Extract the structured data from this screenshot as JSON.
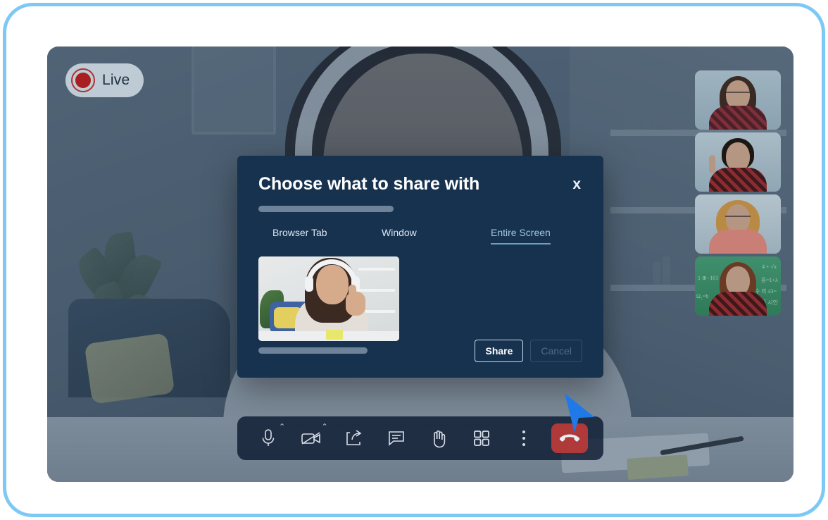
{
  "stage": {
    "live_badge": {
      "label": "Live",
      "icon": "record-dot-icon",
      "dot_color": "#a81f1f",
      "pill_color": "#dfe9f0"
    },
    "main_video_description": "Woman wearing white headphones smiling at camera"
  },
  "participants": [
    {
      "name_icon": "participant-thumbnail",
      "description": "Woman with glasses in plaid shirt"
    },
    {
      "name_icon": "participant-thumbnail",
      "description": "Man in red plaid shirt raising index finger"
    },
    {
      "name_icon": "participant-thumbnail",
      "description": "Woman with curly blonde hair in pink top"
    },
    {
      "name_icon": "participant-thumbnail",
      "description": "Woman in red plaid shirt in front of green chalkboard"
    }
  ],
  "modal": {
    "title": "Choose what to share with",
    "close_label": "x",
    "tabs": [
      {
        "label": "Browser Tab",
        "active": false
      },
      {
        "label": "Window",
        "active": false
      },
      {
        "label": "Entire Screen",
        "active": true
      }
    ],
    "preview_description": "Woman with headphones giving a thumbs up at a desk",
    "share_label": "Share",
    "cancel_label": "Cancel",
    "background_color": "#16324f",
    "active_tab_color": "#9fc4e4"
  },
  "toolbar": {
    "items": [
      {
        "icon": "microphone-icon",
        "has_chevron": true
      },
      {
        "icon": "camera-off-icon",
        "has_chevron": true
      },
      {
        "icon": "share-screen-icon",
        "has_chevron": false
      },
      {
        "icon": "chat-icon",
        "has_chevron": false
      },
      {
        "icon": "raise-hand-icon",
        "has_chevron": false
      },
      {
        "icon": "grid-view-icon",
        "has_chevron": false
      },
      {
        "icon": "more-options-icon",
        "has_chevron": false
      }
    ],
    "end_call": {
      "icon": "end-call-icon",
      "color": "#b03a3a"
    },
    "chevron_glyph": "⌃"
  },
  "cursor": {
    "icon": "pointer-arrow-icon",
    "color": "#1f7ae8"
  },
  "frame": {
    "border_color": "#7ec8f5"
  }
}
